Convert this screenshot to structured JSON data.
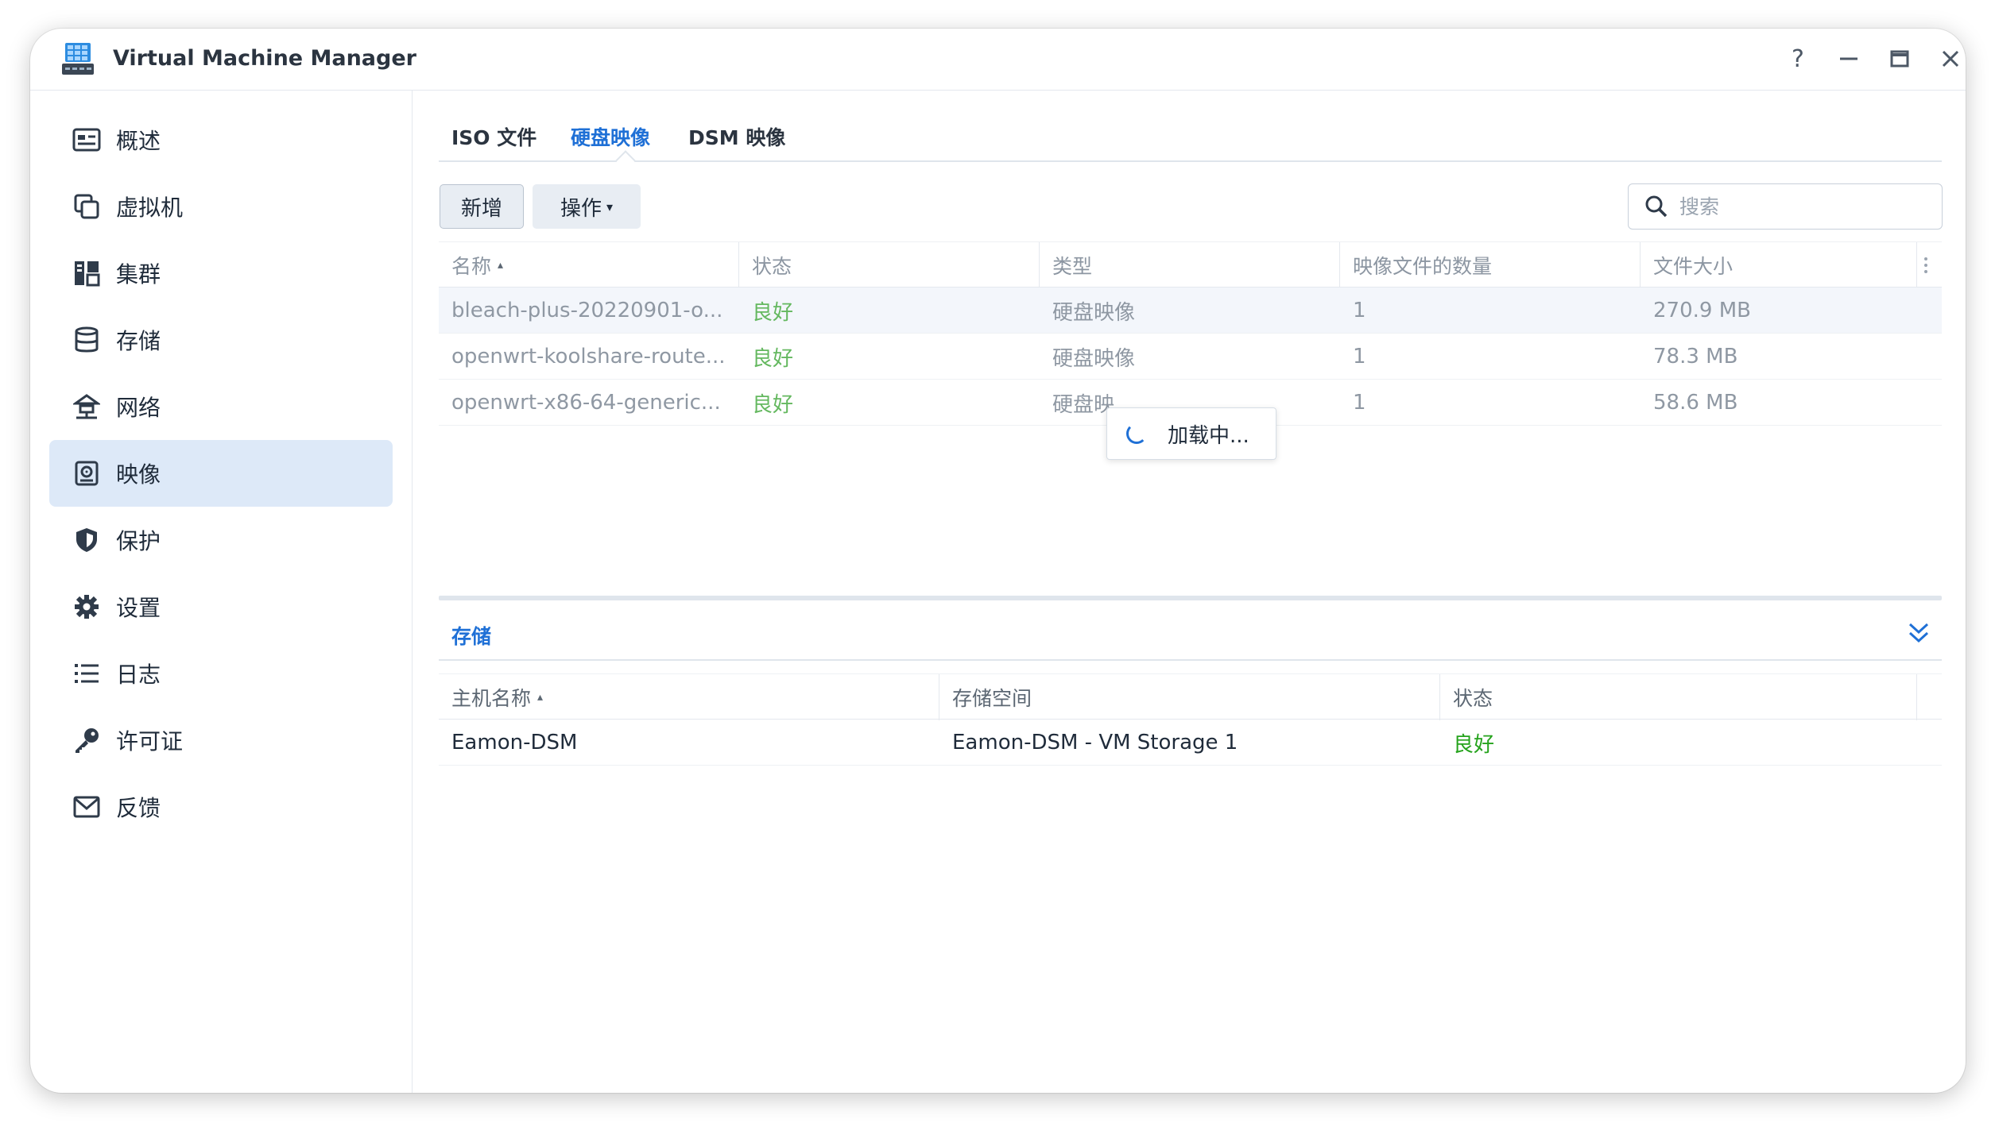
{
  "window": {
    "title": "Virtual Machine Manager",
    "help": "?",
    "minimize": "—",
    "maximize": "▭",
    "close": "✕"
  },
  "sidebar": {
    "items": [
      {
        "label": "概述",
        "icon": "overview-icon"
      },
      {
        "label": "虚拟机",
        "icon": "vm-icon"
      },
      {
        "label": "集群",
        "icon": "cluster-icon"
      },
      {
        "label": "存储",
        "icon": "storage-icon"
      },
      {
        "label": "网络",
        "icon": "network-icon"
      },
      {
        "label": "映像",
        "icon": "image-icon",
        "active": true
      },
      {
        "label": "保护",
        "icon": "shield-icon"
      },
      {
        "label": "设置",
        "icon": "gear-icon"
      },
      {
        "label": "日志",
        "icon": "log-list-icon"
      },
      {
        "label": "许可证",
        "icon": "key-icon"
      },
      {
        "label": "反馈",
        "icon": "mail-icon"
      }
    ]
  },
  "tabs": [
    {
      "label": "ISO 文件"
    },
    {
      "label": "硬盘映像",
      "active": true
    },
    {
      "label": "DSM 映像"
    }
  ],
  "toolbar": {
    "add_label": "新增",
    "ops_label": "操作",
    "ops_caret": "▾",
    "search_placeholder": "搜索"
  },
  "images_table": {
    "columns": [
      "名称",
      "状态",
      "类型",
      "映像文件的数量",
      "文件大小"
    ],
    "sort_indicator": "▴",
    "rows": [
      {
        "name": "bleach-plus-20220901-o...",
        "status": "良好",
        "type": "硬盘映像",
        "count": "1",
        "size": "270.9 MB"
      },
      {
        "name": "openwrt-koolshare-route...",
        "status": "良好",
        "type": "硬盘映像",
        "count": "1",
        "size": "78.3 MB"
      },
      {
        "name": "openwrt-x86-64-generic...",
        "status": "良好",
        "type": "硬盘映",
        "count": "1",
        "size": "58.6 MB"
      }
    ]
  },
  "loading": {
    "text": "加载中..."
  },
  "storage_panel": {
    "title": "存储",
    "columns": [
      "主机名称",
      "存储空间",
      "状态"
    ],
    "rows": [
      {
        "host": "Eamon-DSM",
        "volume": "Eamon-DSM - VM Storage 1",
        "status": "良好"
      }
    ]
  },
  "colors": {
    "accent": "#1f70d6",
    "ok": "#64b85f",
    "active_bg": "#dde9f8"
  }
}
